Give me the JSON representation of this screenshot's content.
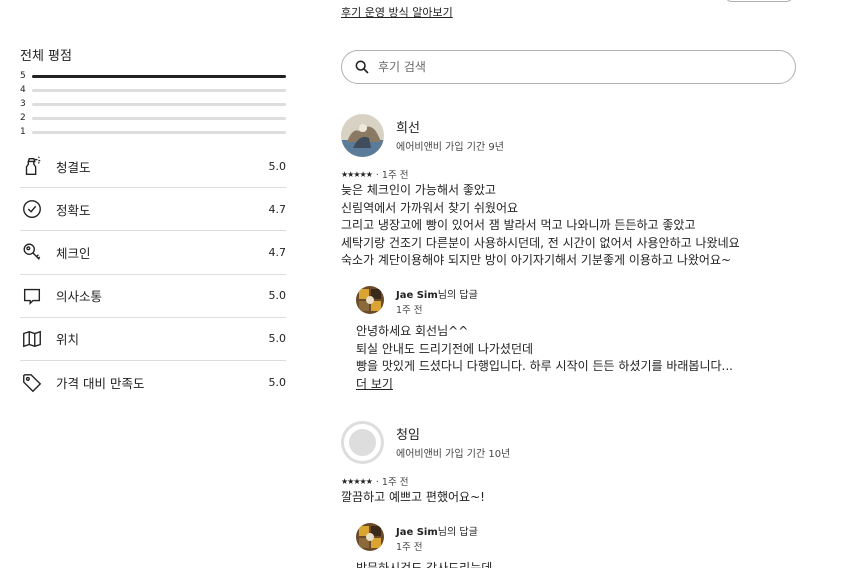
{
  "top": {
    "clipped_left_text": "",
    "guide_link": "후기 운영 방식 알아보기"
  },
  "overall": {
    "title": "전체 평점",
    "bars": [
      {
        "label": "5",
        "fill": 1.0
      },
      {
        "label": "4",
        "fill": 0.0
      },
      {
        "label": "3",
        "fill": 0.0
      },
      {
        "label": "2",
        "fill": 0.0
      },
      {
        "label": "1",
        "fill": 0.0
      }
    ]
  },
  "categories": [
    {
      "label": "청결도",
      "score": "5.0",
      "icon": "spray-bottle-icon"
    },
    {
      "label": "정확도",
      "score": "4.7",
      "icon": "check-circle-icon"
    },
    {
      "label": "체크인",
      "score": "4.7",
      "icon": "key-icon"
    },
    {
      "label": "의사소통",
      "score": "5.0",
      "icon": "speech-bubble-icon"
    },
    {
      "label": "위치",
      "score": "5.0",
      "icon": "map-icon"
    },
    {
      "label": "가격 대비 만족도",
      "score": "5.0",
      "icon": "price-tag-icon"
    }
  ],
  "search": {
    "placeholder": "후기 검색"
  },
  "reviews": [
    {
      "name": "희선",
      "meta": "에어비앤비 가입 기간 9년",
      "stars": "★★★★★",
      "time": "· 1주 전",
      "lines": [
        "늦은 체크인이 가능해서 좋았고",
        "신림역에서 가까워서 찾기 쉬웠어요",
        "그리고 냉장고에 빵이 있어서 잼 발라서 먹고 나와니까 든든하고 좋았고",
        "세탁기랑 건조기 다른분이 사용하시던데, 전 시간이 없어서 사용안하고 나왔네요",
        "숙소가 계단이용해야 되지만 방이 아기자기해서 기분좋게 이용하고 나왔어요~"
      ],
      "reply": {
        "host": "Jae Sim",
        "suffix": "님의 답글",
        "time": "1주 전",
        "lines": [
          "안녕하세요 회선님^^",
          "퇴실 안내도 드리기전에 나가셨던데",
          "빵을 맛있게 드셨다니 다행입니다. 하루 시작이 든든 하셨기를 바래봅니다..."
        ],
        "more": "더 보기"
      }
    },
    {
      "name": "청임",
      "meta": "에어비앤비 가입 기간 10년",
      "stars": "★★★★★",
      "time": "· 1주 전",
      "lines": [
        "깔끔하고 예쁘고 편했어요~!"
      ],
      "reply": {
        "host": "Jae Sim",
        "suffix": "님의 답글",
        "time": "1주 전",
        "lines": [
          "방문하시것도 감사드리는데"
        ]
      }
    }
  ]
}
